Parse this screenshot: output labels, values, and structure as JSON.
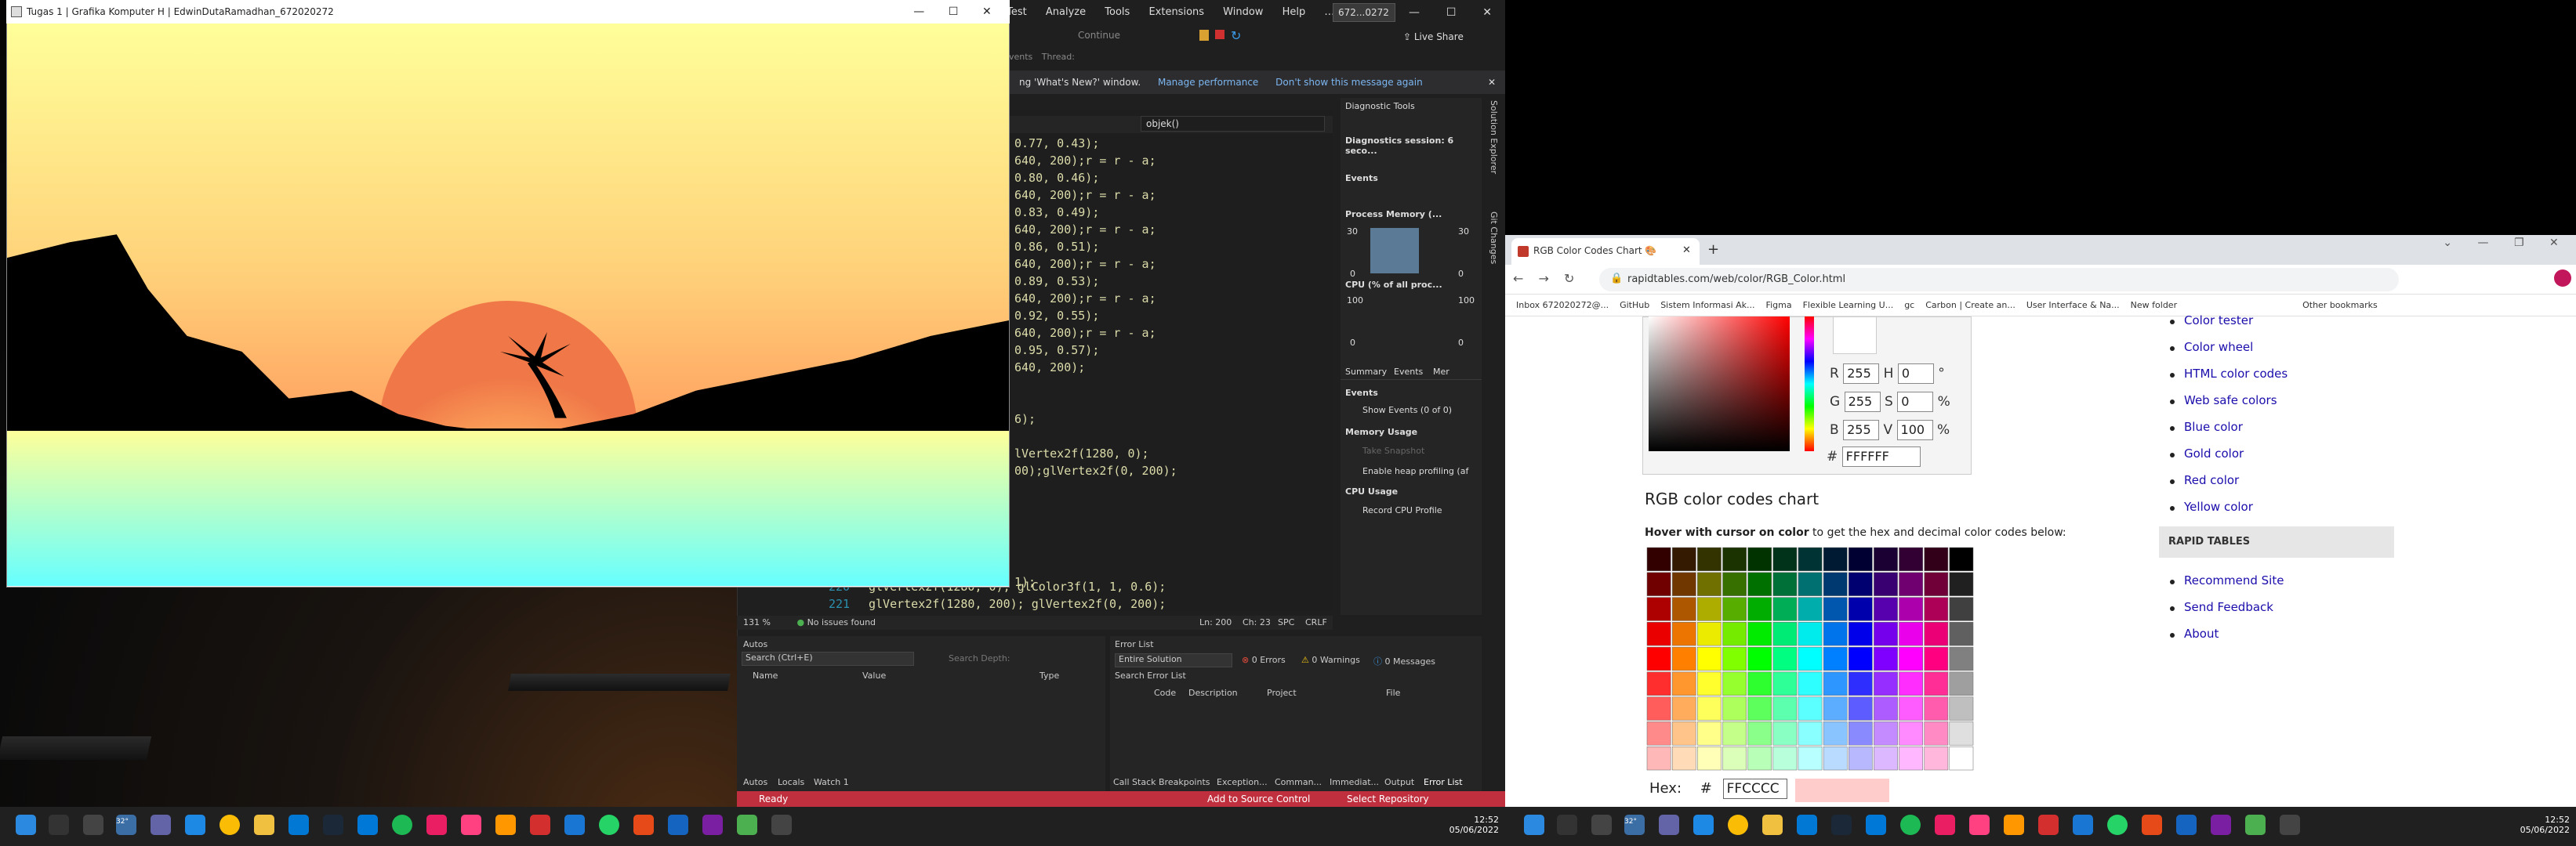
{
  "gl_window": {
    "title": "Tugas 1 | Grafika Komputer H | EdwinDutaRamadhan_672020272"
  },
  "vs": {
    "menu": [
      "Test",
      "Analyze",
      "Tools",
      "Extensions",
      "Window",
      "Help"
    ],
    "more": "…",
    "search_label": "672...0272",
    "toolbar_continue": "Continue",
    "thread_label": "Thread:",
    "events_label": "Events",
    "live_share": "Live Share",
    "infobar": {
      "text": "ng 'What's New?' window.",
      "link1": "Manage performance",
      "link2": "Don't show this message again"
    },
    "scope_dropdown": ")",
    "member_dropdown": "objek()",
    "code_lines": [
      "0.77, 0.43);",
      "640, 200);r = r - a;",
      "0.80, 0.46);",
      "640, 200);r = r - a;",
      "0.83, 0.49);",
      "640, 200);r = r - a;",
      "0.86, 0.51);",
      "640, 200);r = r - a;",
      "0.89, 0.53);",
      "640, 200);r = r - a;",
      "0.92, 0.55);",
      "640, 200);r = r - a;",
      "0.95, 0.57);",
      "640, 200);",
      "6);",
      "lVertex2f(1280, 0);",
      "00);glVertex2f(0, 200);",
      "1);"
    ],
    "line220": {
      "num": "220",
      "code": "glVertex2f(1280, 0); glColor3f(1, 1, 0.6);"
    },
    "line221": {
      "num": "221",
      "code": "glVertex2f(1280, 200); glVertex2f(0, 200);"
    },
    "zoom": "131 %",
    "issues": "No issues found",
    "cursor": {
      "ln": "Ln: 200",
      "ch": "Ch: 23",
      "spc": "SPC",
      "crlf": "CRLF"
    },
    "diag": {
      "title": "Diagnostic Tools",
      "session": "Diagnostics session: 6 seco...",
      "events": "Events",
      "process_memory": "Process Memory (...",
      "pm_max": "30",
      "pm_min": "0",
      "cpu": "CPU (% of all proc...",
      "cpu_max": "100",
      "cpu_min": "0",
      "tabs": [
        "Summary",
        "Events",
        "Mer"
      ],
      "sec_events": "Events",
      "show_events": "Show Events (0 of 0)",
      "sec_mem": "Memory Usage",
      "take_snapshot": "Take Snapshot",
      "heap": "Enable heap profiling (af",
      "sec_cpu": "CPU Usage",
      "record_cpu": "Record CPU Profile"
    },
    "side_tabs": [
      "Solution Explorer",
      "Git Changes"
    ],
    "autos": {
      "title": "Autos",
      "search": "Search (Ctrl+E)",
      "depth": "Search Depth:",
      "cols": [
        "Name",
        "Value",
        "Type"
      ],
      "tabs": [
        "Autos",
        "Locals",
        "Watch 1"
      ]
    },
    "errors": {
      "title": "Error List",
      "scope": "Entire Solution",
      "errors": "0 Errors",
      "warnings": "0 Warnings",
      "messages": "0 Messages",
      "search": "Search Error List",
      "cols": [
        "Code",
        "Description",
        "Project",
        "File"
      ],
      "tabs": [
        "Call Stack",
        "Breakpoints",
        "Exception...",
        "Comman...",
        "Immediat...",
        "Output",
        "Error List"
      ]
    },
    "status": {
      "ready": "Ready",
      "source": "Add to Source Control",
      "repo": "Select Repository"
    }
  },
  "taskbar_left": {
    "temp": "32°",
    "time": "12:52",
    "date": "05/06/2022"
  },
  "chrome": {
    "tab_title": "RGB Color Codes Chart 🎨",
    "url": "rapidtables.com/web/color/RGB_Color.html",
    "bookmarks": [
      "Inbox 672020272@...",
      "GitHub",
      "Sistem Informasi Ak...",
      "Figma",
      "Flexible Learning U...",
      "gc",
      "Carbon | Create an...",
      "User Interface & Na...",
      "New folder",
      "Other bookmarks"
    ],
    "picker": {
      "r_label": "R",
      "r": "255",
      "h_label": "H",
      "h": "0",
      "deg": "°",
      "g_label": "G",
      "g": "255",
      "s_label": "S",
      "s": "0",
      "pct1": "%",
      "b_label": "B",
      "b": "255",
      "v_label": "V",
      "v": "100",
      "pct2": "%",
      "hash": "#",
      "hex": "FFFFFF"
    },
    "chart_title": "RGB color codes chart",
    "hint_bold": "Hover with cursor on color",
    "hint_rest": " to get the hex and decimal color codes below:",
    "hex_label": "Hex:",
    "hex_hash": "#",
    "hex_value": "FFCCCC",
    "hex_color": "#FFCCCC",
    "side_links_top": [
      "Color tester",
      "Color wheel",
      "HTML color codes",
      "Web safe colors",
      "Blue color",
      "Gold color",
      "Red color",
      "Yellow color"
    ],
    "rt_title": "RAPID TABLES",
    "side_links_bottom": [
      "Recommend Site",
      "Send Feedback",
      "About"
    ]
  },
  "taskbar_right": {
    "temp": "32°",
    "time": "12:52",
    "date": "05/06/2022"
  }
}
